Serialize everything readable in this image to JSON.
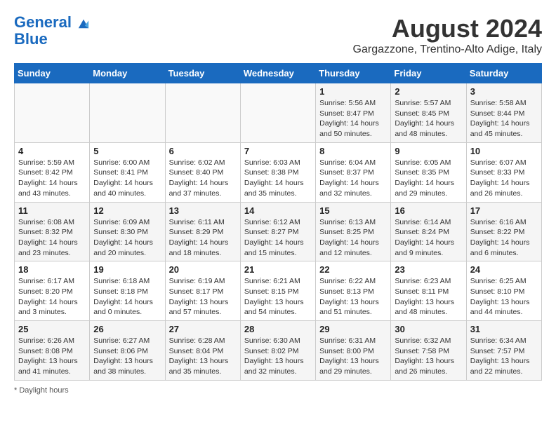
{
  "logo": {
    "line1": "General",
    "line2": "Blue"
  },
  "title": "August 2024",
  "subtitle": "Gargazzone, Trentino-Alto Adige, Italy",
  "days_of_week": [
    "Sunday",
    "Monday",
    "Tuesday",
    "Wednesday",
    "Thursday",
    "Friday",
    "Saturday"
  ],
  "weeks": [
    [
      {
        "day": "",
        "info": ""
      },
      {
        "day": "",
        "info": ""
      },
      {
        "day": "",
        "info": ""
      },
      {
        "day": "",
        "info": ""
      },
      {
        "day": "1",
        "info": "Sunrise: 5:56 AM\nSunset: 8:47 PM\nDaylight: 14 hours\nand 50 minutes."
      },
      {
        "day": "2",
        "info": "Sunrise: 5:57 AM\nSunset: 8:45 PM\nDaylight: 14 hours\nand 48 minutes."
      },
      {
        "day": "3",
        "info": "Sunrise: 5:58 AM\nSunset: 8:44 PM\nDaylight: 14 hours\nand 45 minutes."
      }
    ],
    [
      {
        "day": "4",
        "info": "Sunrise: 5:59 AM\nSunset: 8:42 PM\nDaylight: 14 hours\nand 43 minutes."
      },
      {
        "day": "5",
        "info": "Sunrise: 6:00 AM\nSunset: 8:41 PM\nDaylight: 14 hours\nand 40 minutes."
      },
      {
        "day": "6",
        "info": "Sunrise: 6:02 AM\nSunset: 8:40 PM\nDaylight: 14 hours\nand 37 minutes."
      },
      {
        "day": "7",
        "info": "Sunrise: 6:03 AM\nSunset: 8:38 PM\nDaylight: 14 hours\nand 35 minutes."
      },
      {
        "day": "8",
        "info": "Sunrise: 6:04 AM\nSunset: 8:37 PM\nDaylight: 14 hours\nand 32 minutes."
      },
      {
        "day": "9",
        "info": "Sunrise: 6:05 AM\nSunset: 8:35 PM\nDaylight: 14 hours\nand 29 minutes."
      },
      {
        "day": "10",
        "info": "Sunrise: 6:07 AM\nSunset: 8:33 PM\nDaylight: 14 hours\nand 26 minutes."
      }
    ],
    [
      {
        "day": "11",
        "info": "Sunrise: 6:08 AM\nSunset: 8:32 PM\nDaylight: 14 hours\nand 23 minutes."
      },
      {
        "day": "12",
        "info": "Sunrise: 6:09 AM\nSunset: 8:30 PM\nDaylight: 14 hours\nand 20 minutes."
      },
      {
        "day": "13",
        "info": "Sunrise: 6:11 AM\nSunset: 8:29 PM\nDaylight: 14 hours\nand 18 minutes."
      },
      {
        "day": "14",
        "info": "Sunrise: 6:12 AM\nSunset: 8:27 PM\nDaylight: 14 hours\nand 15 minutes."
      },
      {
        "day": "15",
        "info": "Sunrise: 6:13 AM\nSunset: 8:25 PM\nDaylight: 14 hours\nand 12 minutes."
      },
      {
        "day": "16",
        "info": "Sunrise: 6:14 AM\nSunset: 8:24 PM\nDaylight: 14 hours\nand 9 minutes."
      },
      {
        "day": "17",
        "info": "Sunrise: 6:16 AM\nSunset: 8:22 PM\nDaylight: 14 hours\nand 6 minutes."
      }
    ],
    [
      {
        "day": "18",
        "info": "Sunrise: 6:17 AM\nSunset: 8:20 PM\nDaylight: 14 hours\nand 3 minutes."
      },
      {
        "day": "19",
        "info": "Sunrise: 6:18 AM\nSunset: 8:18 PM\nDaylight: 14 hours\nand 0 minutes."
      },
      {
        "day": "20",
        "info": "Sunrise: 6:19 AM\nSunset: 8:17 PM\nDaylight: 13 hours\nand 57 minutes."
      },
      {
        "day": "21",
        "info": "Sunrise: 6:21 AM\nSunset: 8:15 PM\nDaylight: 13 hours\nand 54 minutes."
      },
      {
        "day": "22",
        "info": "Sunrise: 6:22 AM\nSunset: 8:13 PM\nDaylight: 13 hours\nand 51 minutes."
      },
      {
        "day": "23",
        "info": "Sunrise: 6:23 AM\nSunset: 8:11 PM\nDaylight: 13 hours\nand 48 minutes."
      },
      {
        "day": "24",
        "info": "Sunrise: 6:25 AM\nSunset: 8:10 PM\nDaylight: 13 hours\nand 44 minutes."
      }
    ],
    [
      {
        "day": "25",
        "info": "Sunrise: 6:26 AM\nSunset: 8:08 PM\nDaylight: 13 hours\nand 41 minutes."
      },
      {
        "day": "26",
        "info": "Sunrise: 6:27 AM\nSunset: 8:06 PM\nDaylight: 13 hours\nand 38 minutes."
      },
      {
        "day": "27",
        "info": "Sunrise: 6:28 AM\nSunset: 8:04 PM\nDaylight: 13 hours\nand 35 minutes."
      },
      {
        "day": "28",
        "info": "Sunrise: 6:30 AM\nSunset: 8:02 PM\nDaylight: 13 hours\nand 32 minutes."
      },
      {
        "day": "29",
        "info": "Sunrise: 6:31 AM\nSunset: 8:00 PM\nDaylight: 13 hours\nand 29 minutes."
      },
      {
        "day": "30",
        "info": "Sunrise: 6:32 AM\nSunset: 7:58 PM\nDaylight: 13 hours\nand 26 minutes."
      },
      {
        "day": "31",
        "info": "Sunrise: 6:34 AM\nSunset: 7:57 PM\nDaylight: 13 hours\nand 22 minutes."
      }
    ]
  ],
  "footer": "Daylight hours"
}
